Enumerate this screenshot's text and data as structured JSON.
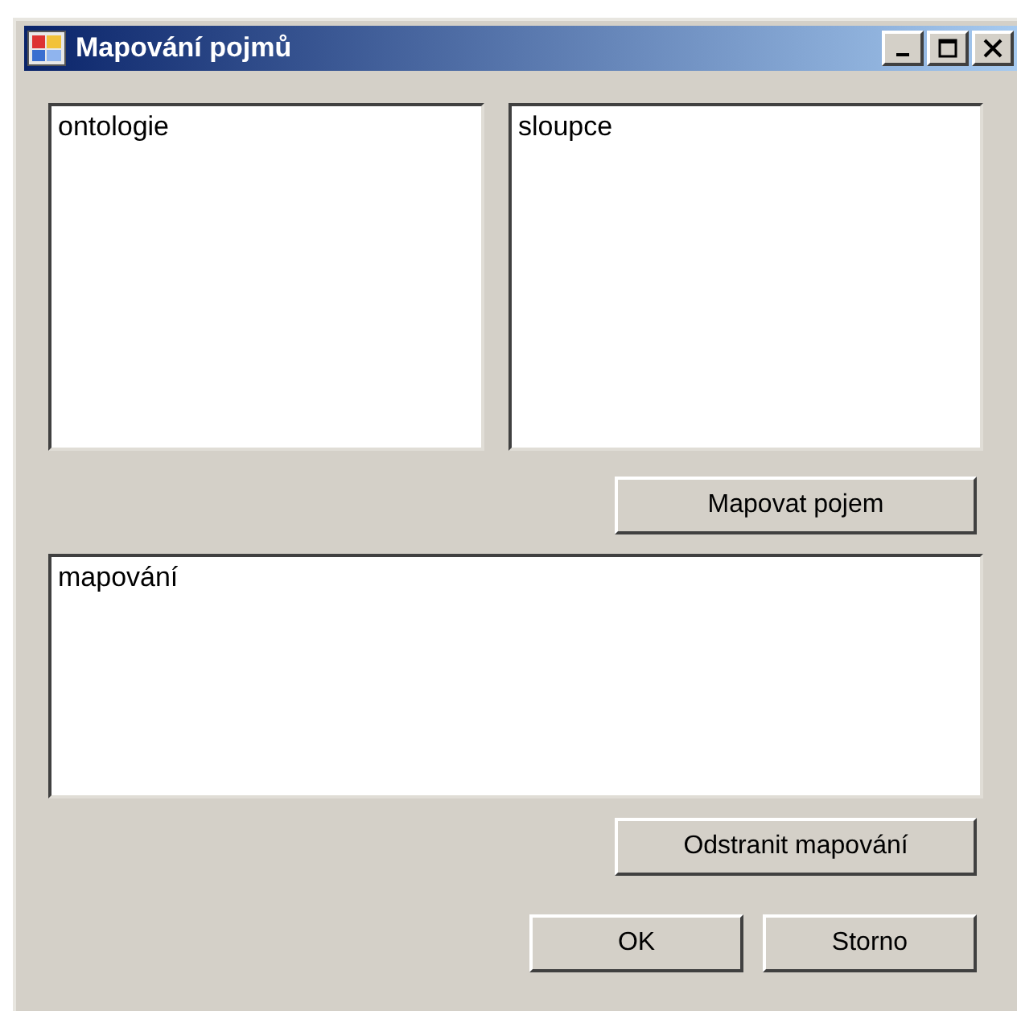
{
  "window": {
    "title": "Mapování pojmů"
  },
  "lists": [
    {
      "items": [
        "ontologie"
      ]
    },
    {
      "items": [
        "sloupce"
      ]
    }
  ],
  "map_button": "Mapovat pojem",
  "mapping_list": {
    "items": [
      "mapování"
    ]
  },
  "remove_button": "Odstranit mapování",
  "buttons": [
    "OK",
    "Storno"
  ]
}
